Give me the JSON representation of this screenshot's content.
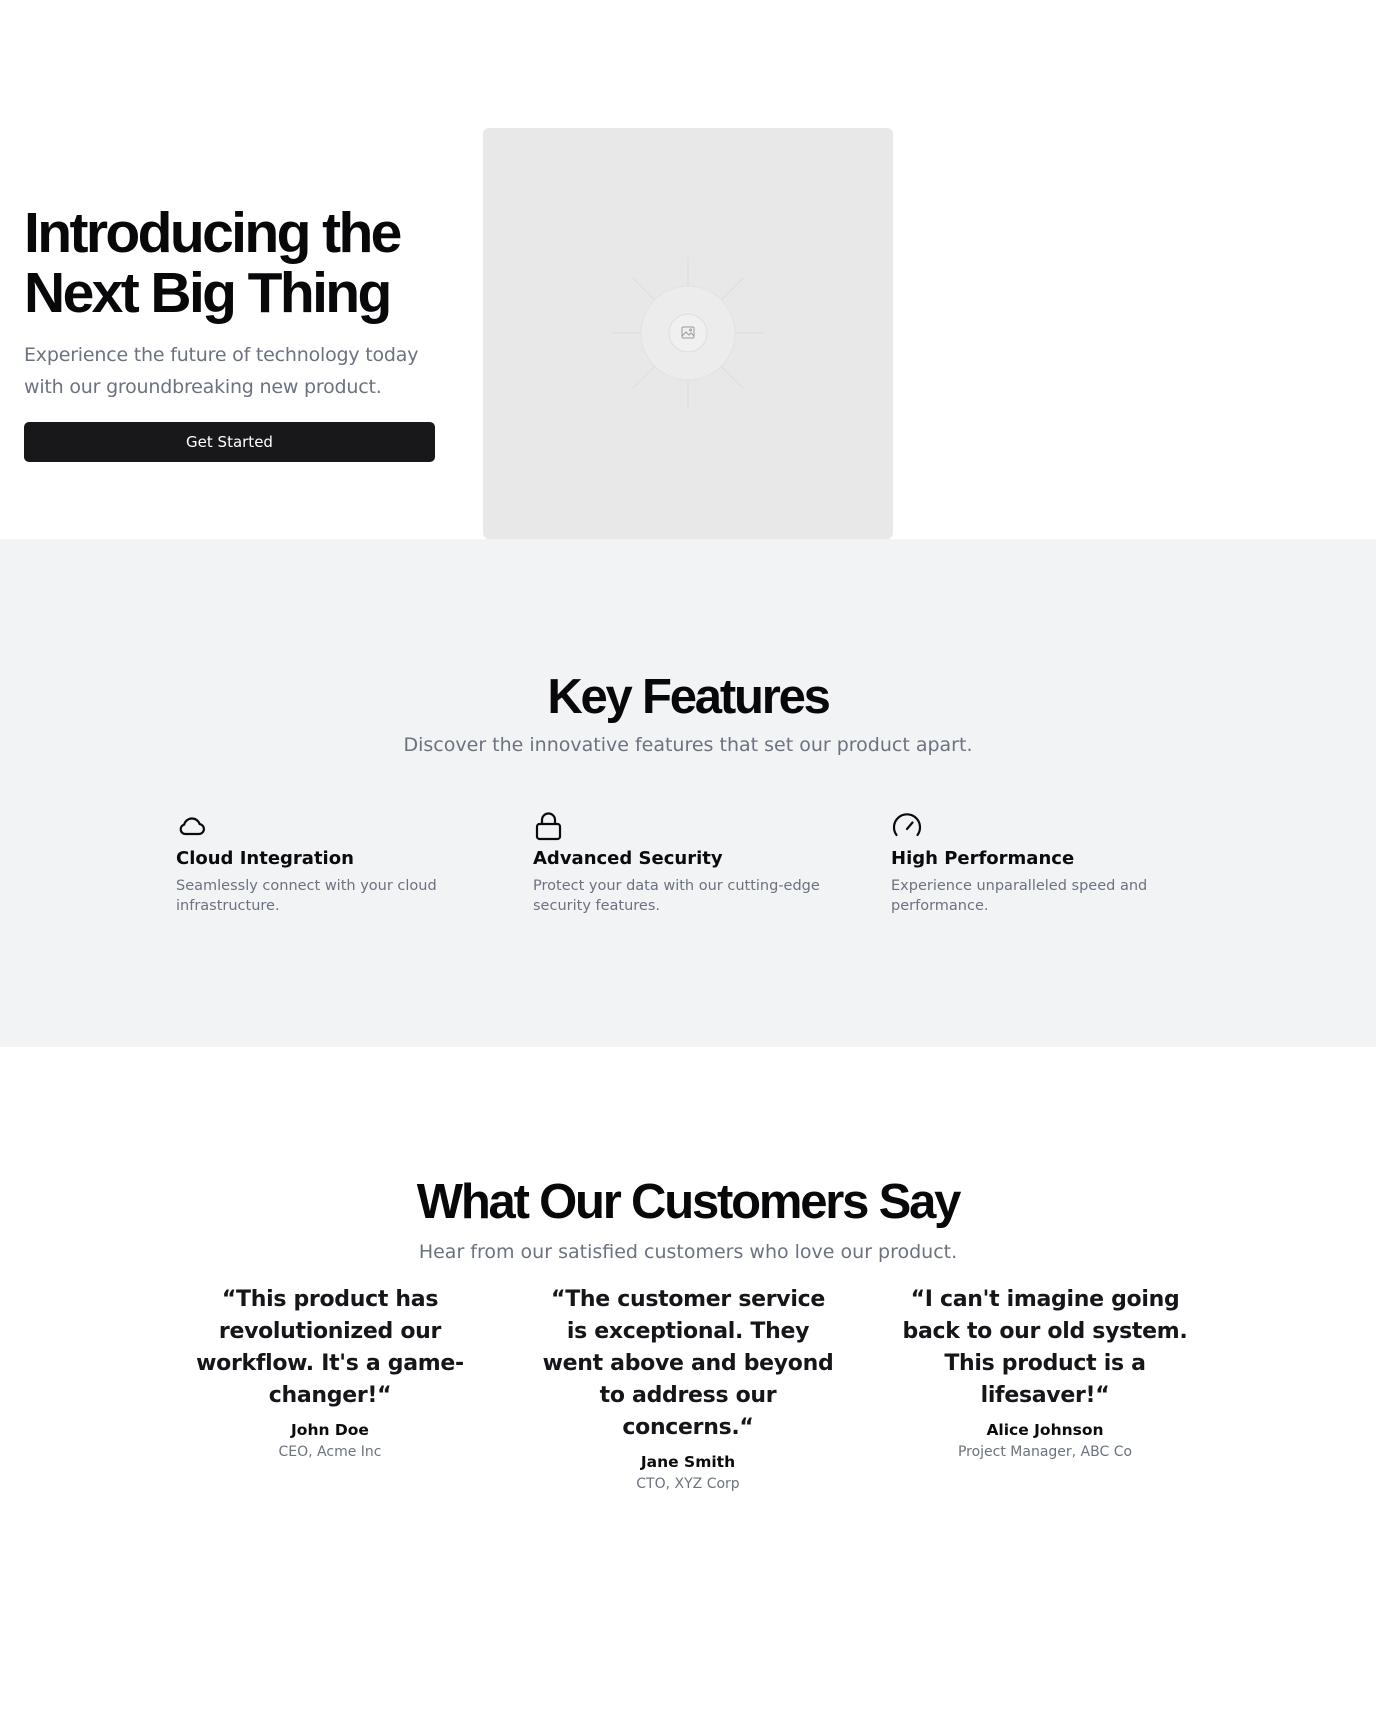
{
  "hero": {
    "title_line1": "Introducing the",
    "title_line2": "Next Big Thing",
    "subtitle": "Experience the future of technology today with our groundbreaking new product.",
    "button_label": "Get Started",
    "image_icon": "image-placeholder-icon"
  },
  "features": {
    "title": "Key Features",
    "subtitle": "Discover the innovative features that set our product apart.",
    "items": [
      {
        "icon": "cloud-icon",
        "title": "Cloud Integration",
        "description": "Seamlessly connect with your cloud infrastructure."
      },
      {
        "icon": "lock-icon",
        "title": "Advanced Security",
        "description": "Protect your data with our cutting-edge security features."
      },
      {
        "icon": "gauge-icon",
        "title": "High Performance",
        "description": "Experience unparalleled speed and performance."
      }
    ]
  },
  "testimonials": {
    "title": "What Our Customers Say",
    "subtitle": "Hear from our satisfied customers who love our product.",
    "items": [
      {
        "quote": "“This product has revolutionized our workflow. It's a game-changer!“",
        "name": "John Doe",
        "role": "CEO, Acme Inc"
      },
      {
        "quote": "“The customer service is exceptional. They went above and beyond to address our concerns.“",
        "name": "Jane Smith",
        "role": "CTO, XYZ Corp"
      },
      {
        "quote": "“I can't imagine going back to our old system. This product is a lifesaver!“",
        "name": "Alice Johnson",
        "role": "Project Manager, ABC Co"
      }
    ]
  },
  "colors": {
    "button_bg": "#18181b",
    "muted_text": "#6b7280",
    "features_bg": "#f2f3f5",
    "image_bg": "#e8e8e9"
  }
}
